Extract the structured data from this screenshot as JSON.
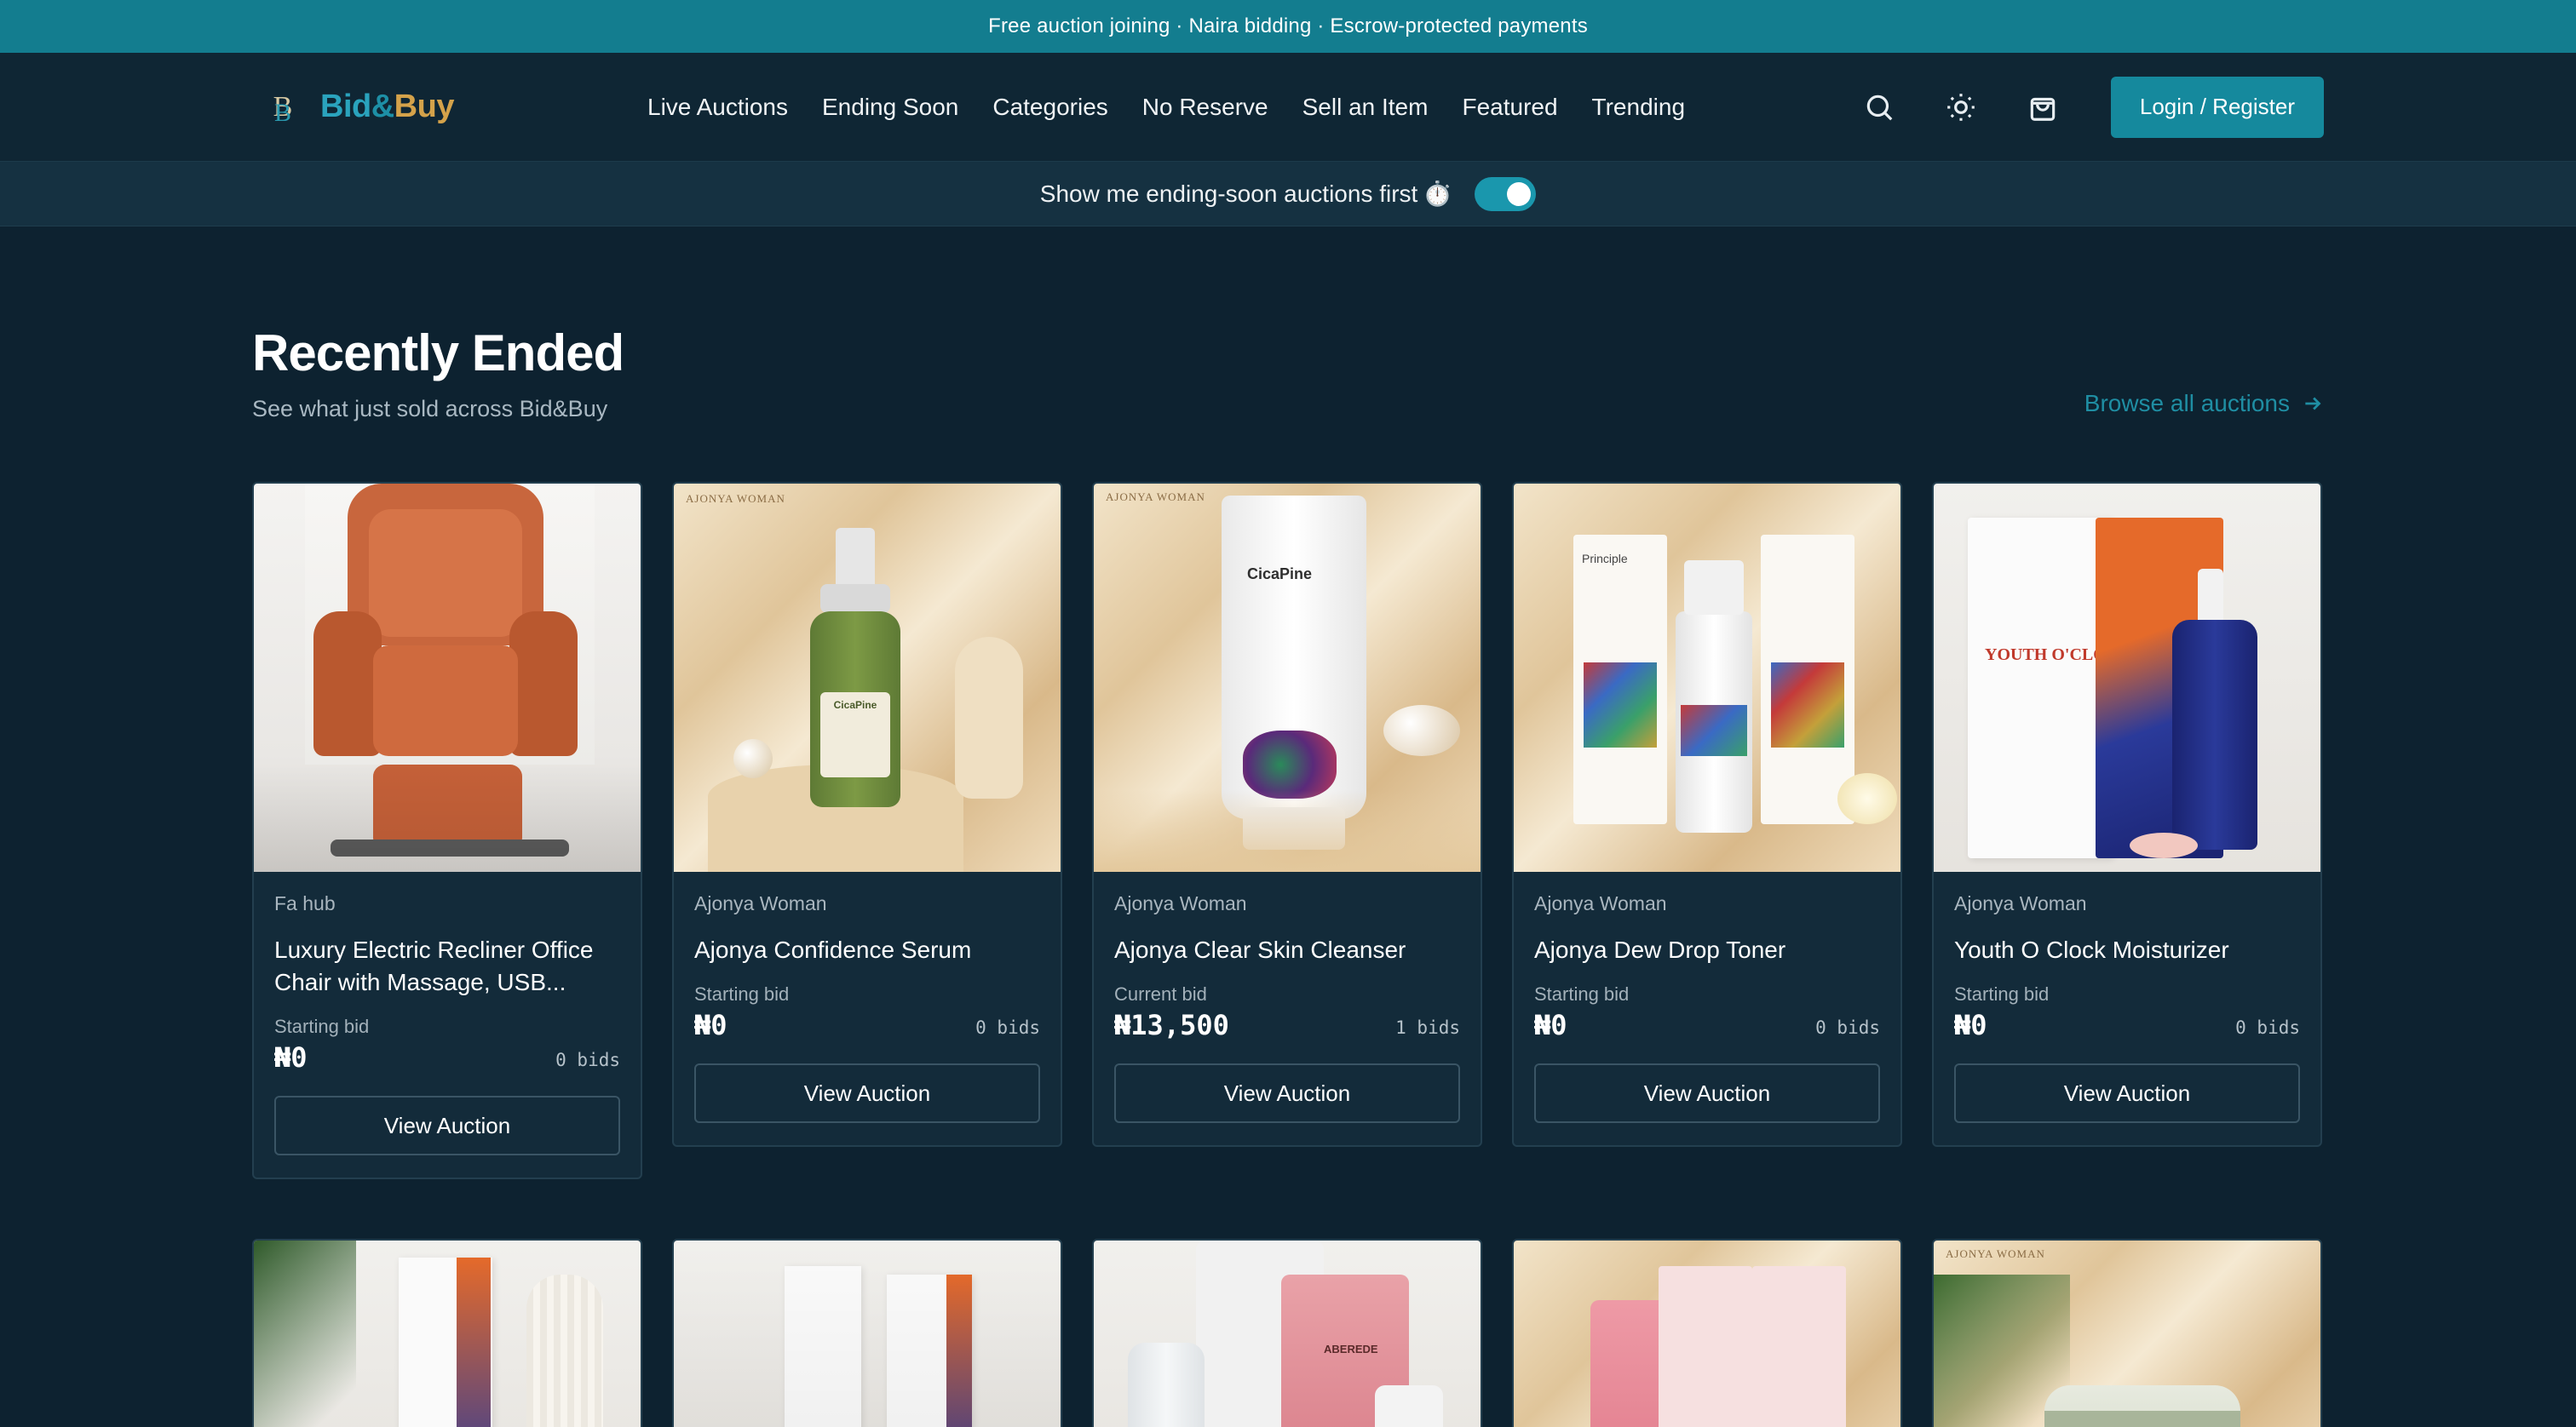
{
  "announcement": "Free auction joining · Naira bidding · Escrow-protected payments",
  "logo": {
    "bid": "Bid",
    "amp": "&",
    "buy": "Buy",
    "mark": "B"
  },
  "nav": [
    "Live Auctions",
    "Ending Soon",
    "Categories",
    "No Reserve",
    "Sell an Item",
    "Featured",
    "Trending"
  ],
  "header": {
    "login_label": "Login / Register"
  },
  "toggle": {
    "label": "Show me ending-soon auctions first",
    "emoji": "⏱️",
    "state": "on"
  },
  "section": {
    "title": "Recently Ended",
    "subtitle": "See what just sold across Bid&Buy",
    "browse_label": "Browse all auctions"
  },
  "cards": [
    {
      "seller": "Fa hub",
      "title": "Luxury Electric Recliner Office Chair with Massage, USB...",
      "price_label": "Starting bid",
      "price": "₦0",
      "bids": "0 bids",
      "button": "View Auction"
    },
    {
      "seller": "Ajonya Woman",
      "title": "Ajonya Confidence Serum",
      "price_label": "Starting bid",
      "price": "₦0",
      "bids": "0 bids",
      "button": "View Auction"
    },
    {
      "seller": "Ajonya Woman",
      "title": "Ajonya Clear Skin Cleanser",
      "price_label": "Current bid",
      "price": "₦13,500",
      "bids": "1 bids",
      "button": "View Auction"
    },
    {
      "seller": "Ajonya Woman",
      "title": "Ajonya Dew Drop Toner",
      "price_label": "Starting bid",
      "price": "₦0",
      "bids": "0 bids",
      "button": "View Auction"
    },
    {
      "seller": "Ajonya Woman",
      "title": "Youth O Clock Moisturizer",
      "price_label": "Starting bid",
      "price": "₦0",
      "bids": "0 bids",
      "button": "View Auction"
    }
  ],
  "image_text": {
    "card2_label": "CicaPine",
    "card3_label": "CicaPine",
    "card4_label": "Principle",
    "card5_label": "YOUTH O'CLOCK",
    "brand": "ABEREDE",
    "watermark": "AJONYA WOMAN"
  },
  "colors": {
    "announce_bg": "#137d8f",
    "accent": "#15899d",
    "page_bg": "#0d2230",
    "card_bg": "#132b3a"
  }
}
